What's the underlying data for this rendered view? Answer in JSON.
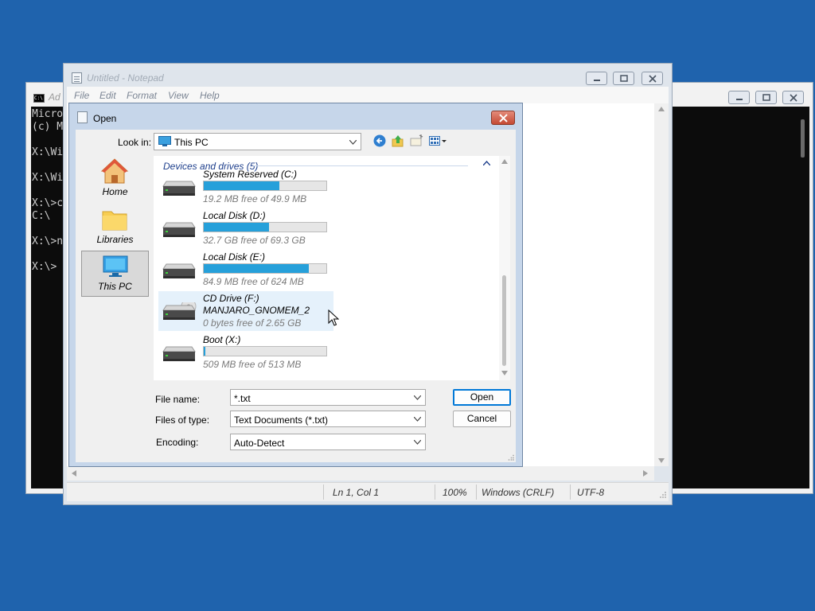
{
  "console": {
    "title": "Ad",
    "lines": [
      "Micro",
      "(c) M",
      "",
      "X:\\Wi",
      "",
      "X:\\Wi",
      "",
      "X:\\>c",
      "C:\\",
      "",
      "X:\\>n",
      "",
      "X:\\>"
    ]
  },
  "notepad": {
    "title": "Untitled - Notepad",
    "menu": [
      "File",
      "Edit",
      "Format",
      "View",
      "Help"
    ],
    "status": {
      "position": "Ln 1, Col 1",
      "zoom": "100%",
      "line_ending": "Windows (CRLF)",
      "encoding": "UTF-8"
    }
  },
  "dialog": {
    "title": "Open",
    "look_in_label": "Look in:",
    "look_in_value": "This PC",
    "places": [
      {
        "label": "Home",
        "icon": "home-icon"
      },
      {
        "label": "Libraries",
        "icon": "libraries-folder-icon"
      },
      {
        "label": "This PC",
        "icon": "this-pc-icon",
        "selected": true
      }
    ],
    "group_header": "Devices and drives (5)",
    "drives": [
      {
        "name": "System Reserved (C:)",
        "free": "19.2 MB free of 49.9 MB",
        "used_fraction": 0.62
      },
      {
        "name": "Local Disk (D:)",
        "free": "32.7 GB free of 69.3 GB",
        "used_fraction": 0.53
      },
      {
        "name": "Local Disk (E:)",
        "free": "84.9 MB free of 624 MB",
        "used_fraction": 0.86
      },
      {
        "name": "CD Drive (F:)",
        "label": "MANJARO_GNOMEM_2",
        "free": "0 bytes free of 2.65 GB"
      },
      {
        "name": "Boot (X:)",
        "free": "509 MB free of 513 MB",
        "used_fraction": 0.01
      }
    ],
    "file_name_label": "File name:",
    "file_name_value": "*.txt",
    "files_of_type_label": "Files of type:",
    "files_of_type_value": "Text Documents (*.txt)",
    "encoding_label": "Encoding:",
    "encoding_value": "Auto-Detect",
    "open_button": "Open",
    "cancel_button": "Cancel"
  }
}
